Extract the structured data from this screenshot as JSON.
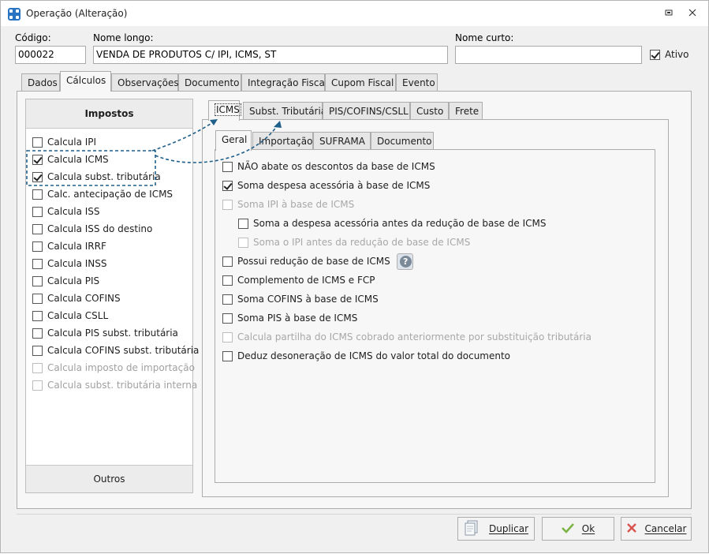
{
  "window": {
    "title": "Operação (Alteração)"
  },
  "header": {
    "codigo_label": "Código:",
    "codigo_value": "000022",
    "nome_longo_label": "Nome longo:",
    "nome_longo_value": "VENDA DE PRODUTOS C/ IPI, ICMS, ST",
    "nome_curto_label": "Nome curto:",
    "nome_curto_value": "",
    "ativo_label": "Ativo",
    "ativo_checked": true
  },
  "main_tabs": [
    "Dados",
    "Cálculos",
    "Observações",
    "Documento",
    "Integração Fiscal",
    "Cupom Fiscal",
    "Evento"
  ],
  "active_main_tab": "Cálculos",
  "impostos": {
    "header": "Impostos",
    "footer": "Outros",
    "items": [
      {
        "label": "Calcula IPI",
        "checked": false,
        "disabled": false
      },
      {
        "label": "Calcula ICMS",
        "checked": true,
        "disabled": false
      },
      {
        "label": "Calcula subst. tributária",
        "checked": true,
        "disabled": false
      },
      {
        "label": "Calc. antecipação de ICMS",
        "checked": false,
        "disabled": false
      },
      {
        "label": "Calcula ISS",
        "checked": false,
        "disabled": false
      },
      {
        "label": "Calcula ISS do destino",
        "checked": false,
        "disabled": false
      },
      {
        "label": "Calcula IRRF",
        "checked": false,
        "disabled": false
      },
      {
        "label": "Calcula INSS",
        "checked": false,
        "disabled": false
      },
      {
        "label": "Calcula PIS",
        "checked": false,
        "disabled": false
      },
      {
        "label": "Calcula COFINS",
        "checked": false,
        "disabled": false
      },
      {
        "label": "Calcula CSLL",
        "checked": false,
        "disabled": false
      },
      {
        "label": "Calcula PIS subst. tributária",
        "checked": false,
        "disabled": false
      },
      {
        "label": "Calcula COFINS subst. tributária",
        "checked": false,
        "disabled": false
      },
      {
        "label": "Calcula imposto de importação",
        "checked": false,
        "disabled": true
      },
      {
        "label": "Calcula subst. tributária interna",
        "checked": false,
        "disabled": true
      }
    ]
  },
  "tax_tabs": [
    "ICMS",
    "Subst. Tributária",
    "PIS/COFINS/CSLL",
    "Custo",
    "Frete"
  ],
  "active_tax_tab": "ICMS",
  "icms_tabs": [
    "Geral",
    "Importação",
    "SUFRAMA",
    "Documento"
  ],
  "active_icms_tab": "Geral",
  "icms_options": [
    {
      "label": "NÃO abate os descontos da base de ICMS",
      "checked": false,
      "disabled": false,
      "indent": 0
    },
    {
      "label": "Soma despesa acessória à base de ICMS",
      "checked": true,
      "disabled": false,
      "indent": 0
    },
    {
      "label": "Soma IPI à base de ICMS",
      "checked": false,
      "disabled": true,
      "indent": 0
    },
    {
      "label": "Soma a despesa acessória antes da redução de base de ICMS",
      "checked": false,
      "disabled": false,
      "indent": 1
    },
    {
      "label": "Soma o IPI antes da redução de base de ICMS",
      "checked": false,
      "disabled": true,
      "indent": 1
    },
    {
      "label": "Possui redução de base de ICMS",
      "checked": false,
      "disabled": false,
      "indent": 0,
      "help": true
    },
    {
      "label": "Complemento de ICMS e FCP",
      "checked": false,
      "disabled": false,
      "indent": 0
    },
    {
      "label": "Soma COFINS à base de ICMS",
      "checked": false,
      "disabled": false,
      "indent": 0
    },
    {
      "label": "Soma PIS à base de ICMS",
      "checked": false,
      "disabled": false,
      "indent": 0
    },
    {
      "label": "Calcula partilha do ICMS cobrado anteriormente por substituição tributária",
      "checked": false,
      "disabled": true,
      "indent": 0
    },
    {
      "label": "Deduz desoneração de ICMS do valor total do documento",
      "checked": false,
      "disabled": false,
      "indent": 0
    }
  ],
  "buttons": {
    "duplicar_label": "Duplicar",
    "ok_label": "Ok",
    "cancelar_label": "Cancelar"
  },
  "colors": {
    "annotation": "#1f5f8b",
    "ok_icon": "#7cb342",
    "cancel_icon": "#d9534f"
  },
  "icons": [
    "app-icon",
    "restore-icon",
    "close-icon",
    "help-icon",
    "duplicate-icon",
    "check-icon",
    "x-icon"
  ]
}
